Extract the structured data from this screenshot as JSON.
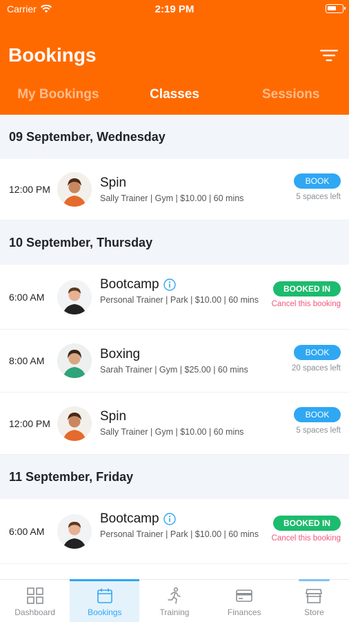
{
  "status_bar": {
    "carrier": "Carrier",
    "time": "2:19 PM"
  },
  "header": {
    "title": "Bookings",
    "filter_icon": "filter-icon"
  },
  "tabs": [
    {
      "label": "My Bookings",
      "active": false
    },
    {
      "label": "Classes",
      "active": true
    },
    {
      "label": "Sessions",
      "active": false
    }
  ],
  "days": [
    {
      "label": "09 September, Wednesday",
      "classes": [
        {
          "time": "12:00 PM",
          "name": "Spin",
          "trainer": "Sally Trainer",
          "meta": "Sally Trainer | Gym | $10.00 | 60 mins",
          "action": "BOOK",
          "sub": "5 spaces left"
        }
      ]
    },
    {
      "label": "10 September, Thursday",
      "classes": [
        {
          "time": "6:00 AM",
          "name": "Bootcamp",
          "meta": "Personal Trainer | Park | $10.00 | 60 mins",
          "action": "BOOKED IN",
          "sub": "Cancel this booking",
          "info_icon": true
        },
        {
          "time": "8:00 AM",
          "name": "Boxing",
          "meta": "Sarah Trainer | Gym | $25.00 | 60 mins",
          "action": "BOOK",
          "sub": "20 spaces left"
        },
        {
          "time": "12:00 PM",
          "name": "Spin",
          "meta": "Sally Trainer | Gym | $10.00 | 60 mins",
          "action": "BOOK",
          "sub": "5 spaces left"
        }
      ]
    },
    {
      "label": "11 September, Friday",
      "classes": [
        {
          "time": "6:00 AM",
          "name": "Bootcamp",
          "meta": "Personal Trainer | Park | $10.00 | 60 mins",
          "action": "BOOKED IN",
          "sub": "Cancel this booking",
          "info_icon": true
        }
      ]
    }
  ],
  "tabbar": [
    {
      "label": "Dashboard",
      "icon": "dashboard-icon"
    },
    {
      "label": "Bookings",
      "icon": "calendar-icon",
      "active": true
    },
    {
      "label": "Training",
      "icon": "running-icon"
    },
    {
      "label": "Finances",
      "icon": "card-icon"
    },
    {
      "label": "Store",
      "icon": "store-icon"
    }
  ],
  "colors": {
    "brand": "#ff6a00",
    "book": "#2fa7f3",
    "booked": "#1dbb6d",
    "cancel": "#f2557a"
  }
}
